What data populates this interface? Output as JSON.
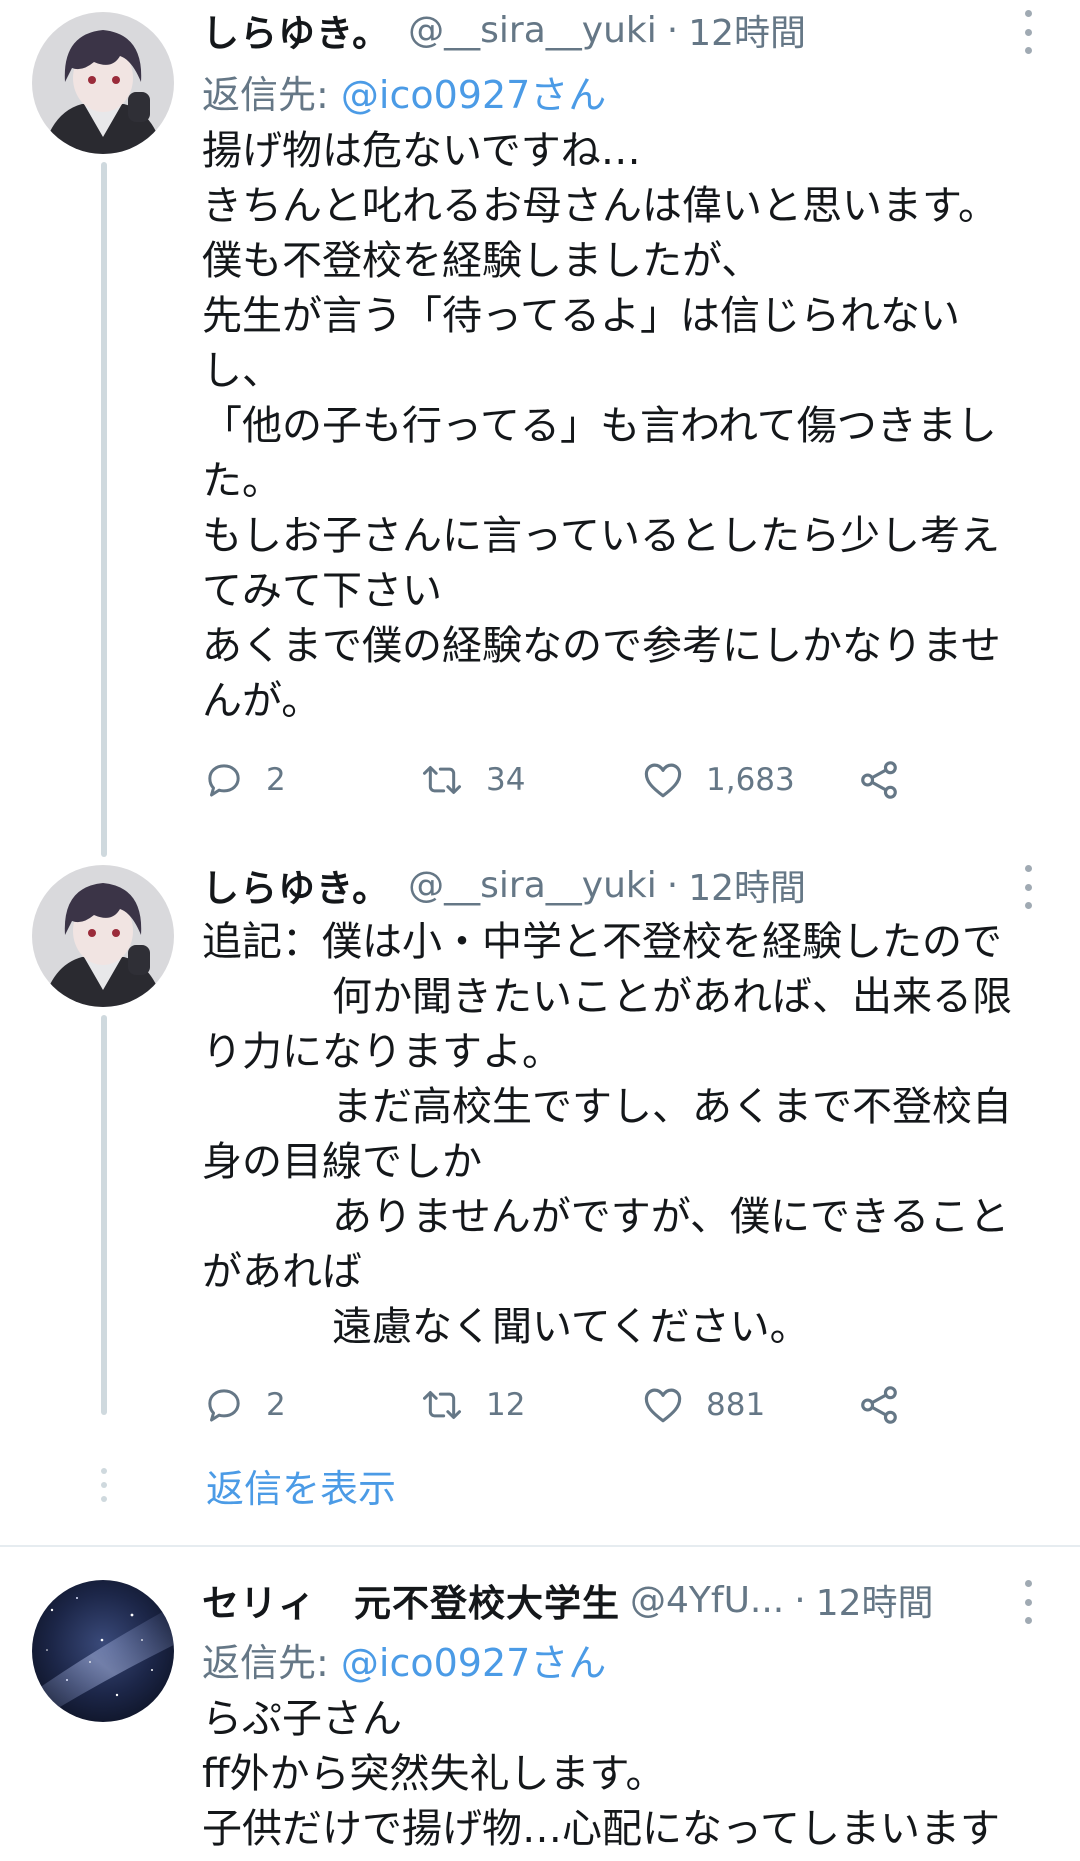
{
  "tweets": [
    {
      "author_name": "しらゆき。",
      "author_handle": "@__sira__yuki",
      "separator": "·",
      "time": "12時間",
      "reply_prefix": "返信先: ",
      "reply_mention": "@ico0927さん",
      "lines": [
        "揚げ物は危ないですね…",
        "きちんと叱れるお母さんは偉いと思います。",
        "僕も不登校を経験しましたが、",
        "先生が言う「待ってるよ」は信じられない",
        "し、",
        "「他の子も行ってる」も言われて傷つきまし",
        "た。",
        "もしお子さんに言っているとしたら少し考え",
        "てみて下さい",
        "あくまで僕の経験なので参考にしかなりませ",
        "んが。"
      ],
      "replies": "2",
      "retweets": "34",
      "likes": "1,683"
    },
    {
      "author_name": "しらゆき。",
      "author_handle": "@__sira__yuki",
      "separator": "·",
      "time": "12時間",
      "lines": [
        "追記：僕は小・中学と不登校を経験したので",
        "何か聞きたいことがあれば、出来る限",
        "り力になりますよ。",
        "まだ高校生ですし、あくまで不登校自",
        "身の目線でしか",
        "ありませんがですが、僕にできること",
        "があれば",
        "遠慮なく聞いてください。"
      ],
      "replies": "2",
      "retweets": "12",
      "likes": "881"
    },
    {
      "author_name": "セリィ　元不登校大学生",
      "author_handle": "@4YfU...",
      "separator": "·",
      "time": "12時間",
      "reply_prefix": "返信先: ",
      "reply_mention": "@ico0927さん",
      "lines": [
        "らぷ子さん",
        "ff外から突然失礼します。",
        "子供だけで揚げ物…心配になってしまいます"
      ]
    }
  ],
  "show_replies_label": "返信を表示",
  "icons": {
    "reply": "reply-icon",
    "retweet": "retweet-icon",
    "like": "heart-icon",
    "share": "share-icon",
    "more": "more-vertical-icon"
  },
  "colors": {
    "link": "#4b9be6",
    "secondary_text": "#657786",
    "text": "#14171a",
    "thread_line": "#cfd9de"
  }
}
